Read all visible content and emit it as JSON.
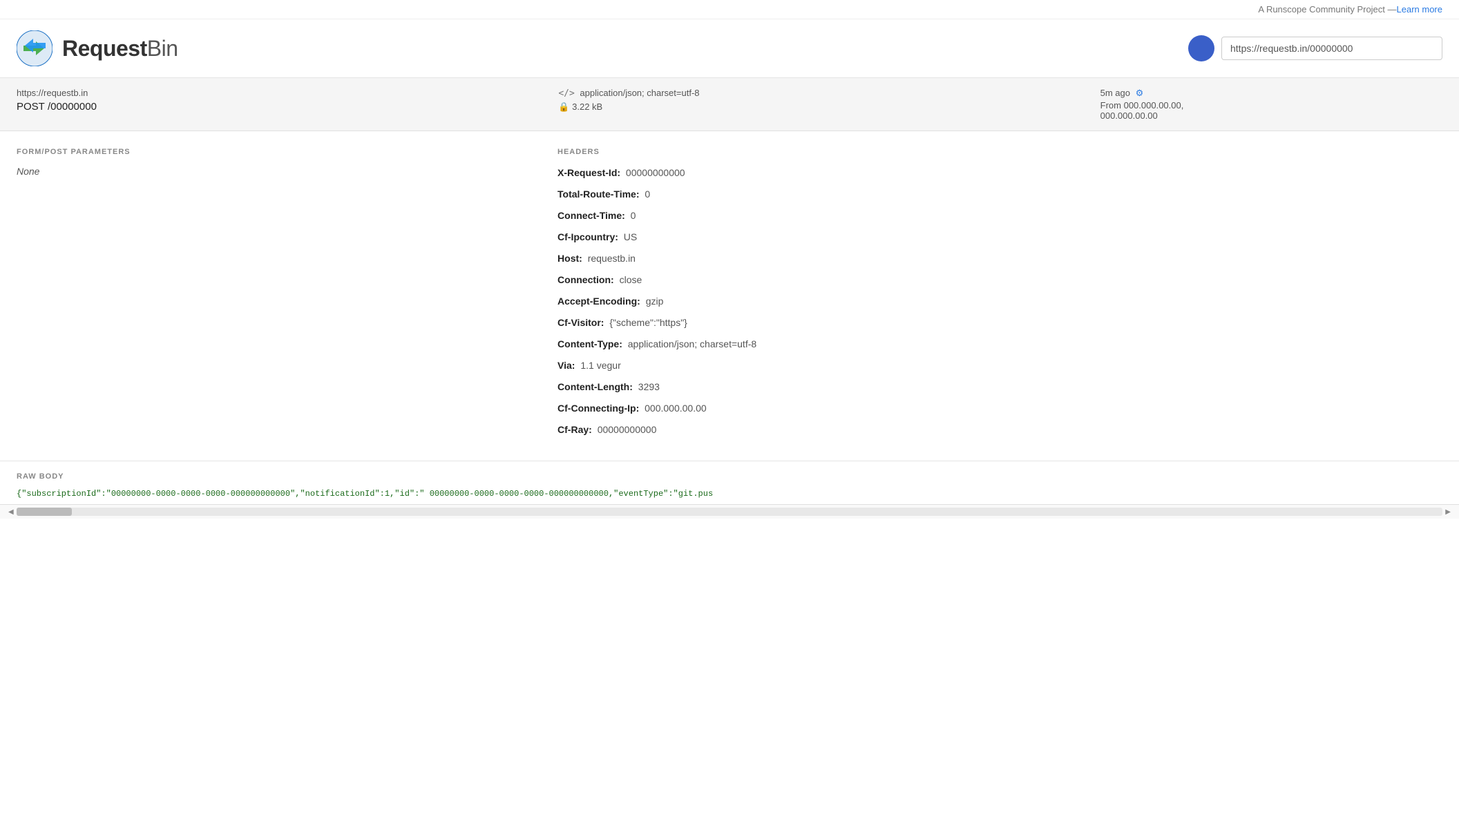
{
  "topbar": {
    "community_text": "A Runscope Community Project — ",
    "learn_more_label": "Learn more"
  },
  "header": {
    "logo_text_request": "Request",
    "logo_text_bin": "Bin",
    "url_input_value": "https://requestb.in/00000000"
  },
  "request_banner": {
    "url": "https://requestb.in",
    "method": "POST",
    "path": "/00000000",
    "content_type_icon": "</>",
    "content_type": "application/json; charset=utf-8",
    "size_icon": "🔒",
    "size": "3.22 kB",
    "time_ago": "5m ago",
    "from_label": "From",
    "from_ip1": "000.000.00.00,",
    "from_ip2": "000.000.00.00"
  },
  "form_post": {
    "section_title": "FORM/POST PARAMETERS",
    "value": "None"
  },
  "headers": {
    "section_title": "HEADERS",
    "items": [
      {
        "key": "X-Request-Id:",
        "value": "00000000000"
      },
      {
        "key": "Total-Route-Time:",
        "value": "0"
      },
      {
        "key": "Connect-Time:",
        "value": "0"
      },
      {
        "key": "Cf-Ipcountry:",
        "value": "US"
      },
      {
        "key": "Host:",
        "value": "requestb.in"
      },
      {
        "key": "Connection:",
        "value": "close"
      },
      {
        "key": "Accept-Encoding:",
        "value": "gzip"
      },
      {
        "key": "Cf-Visitor:",
        "value": "{\"scheme\":\"https\"}"
      },
      {
        "key": "Content-Type:",
        "value": "application/json; charset=utf-8"
      },
      {
        "key": "Via:",
        "value": "1.1 vegur"
      },
      {
        "key": "Content-Length:",
        "value": "3293"
      },
      {
        "key": "Cf-Connecting-Ip:",
        "value": "000.000.00.00"
      },
      {
        "key": "Cf-Ray:",
        "value": "00000000000"
      }
    ]
  },
  "raw_body": {
    "section_title": "RAW BODY",
    "content": "{\"subscriptionId\":\"00000000-0000-0000-0000-000000000000\",\"notificationId\":1,\"id\":\" 00000000-0000-0000-0000-000000000000,\"eventType\":\"git.pus"
  }
}
